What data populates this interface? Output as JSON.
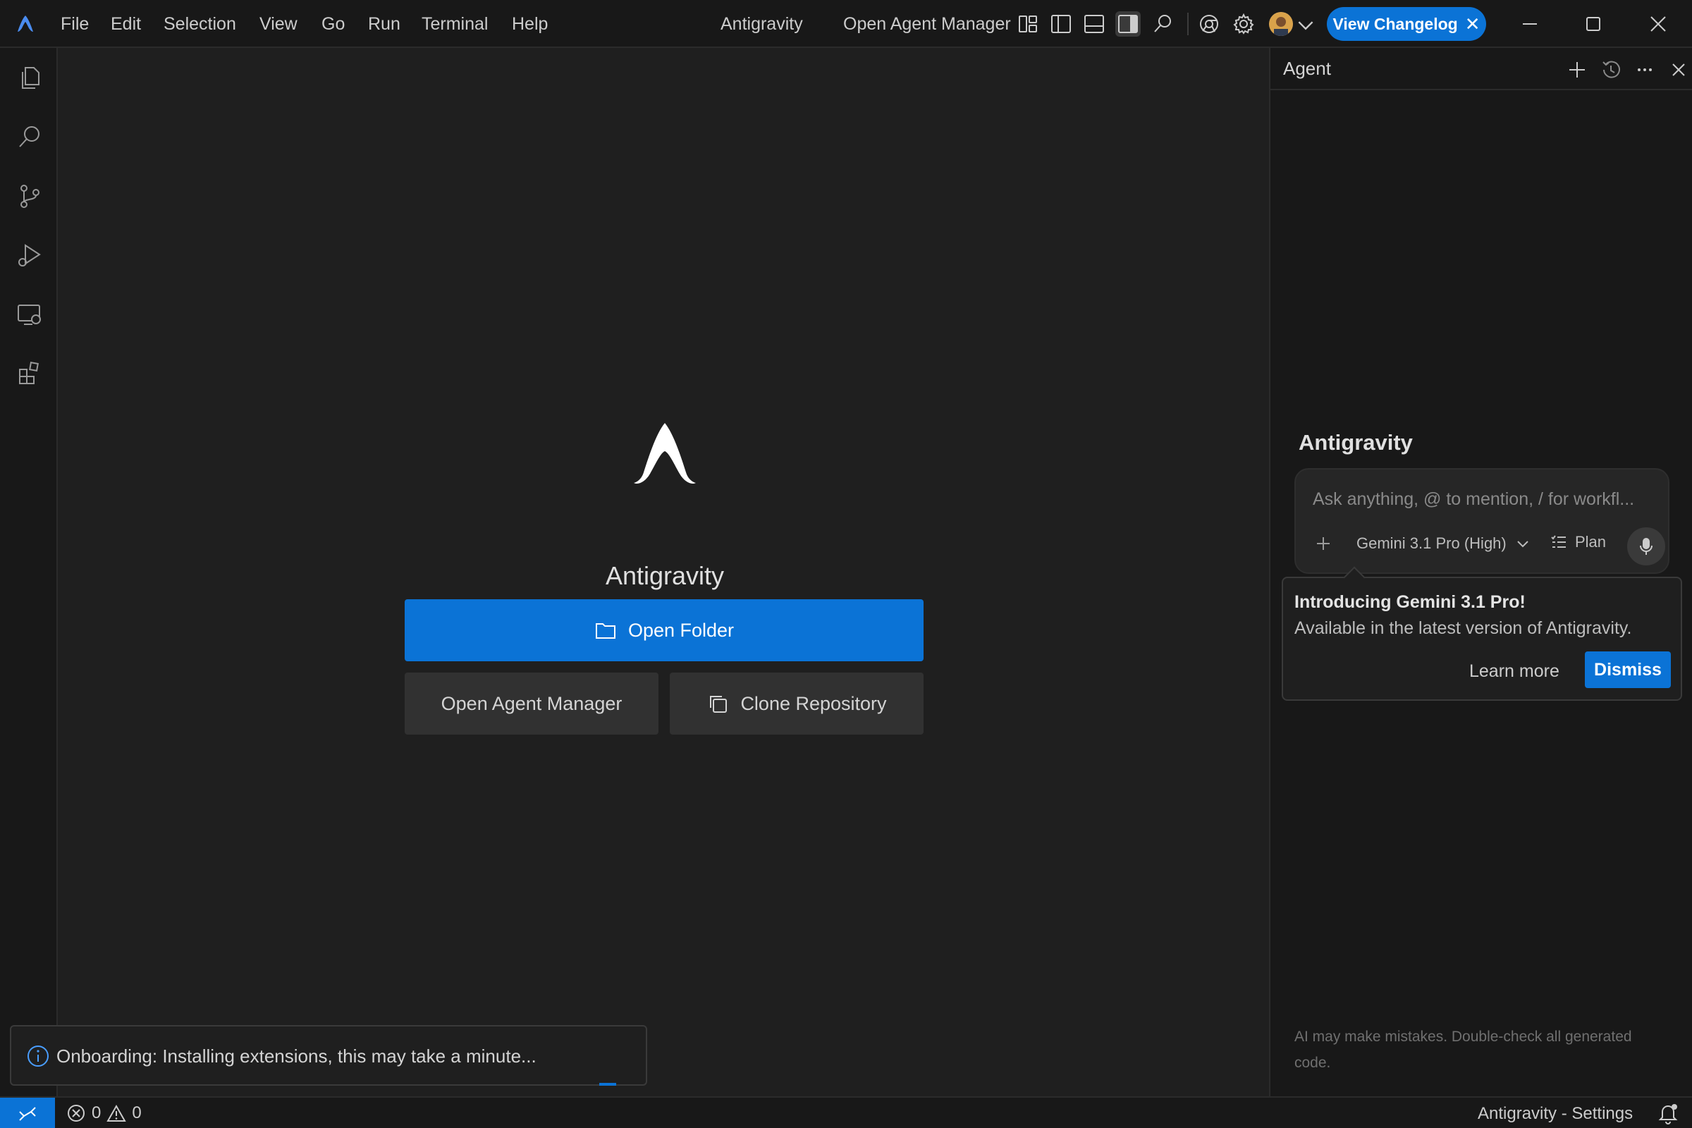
{
  "titlebar": {
    "menu": [
      "File",
      "Edit",
      "Selection",
      "View",
      "Go",
      "Run",
      "Terminal",
      "Help"
    ],
    "window_title": "Antigravity",
    "agent_manager_label": "Open Agent Manager",
    "changelog_label": "View Changelog",
    "changelog_close": "✕"
  },
  "welcome": {
    "title": "Antigravity",
    "open_folder": "Open Folder",
    "open_agent_manager": "Open Agent Manager",
    "clone_repository": "Clone Repository"
  },
  "agent": {
    "header_title": "Agent",
    "brand": "Antigravity",
    "input_placeholder": "Ask anything, @ to mention, / for workfl...",
    "model": "Gemini 3.1 Pro (High)",
    "plan": "Plan",
    "notification": {
      "title": "Introducing Gemini 3.1 Pro!",
      "body": "Available in the latest version of Antigravity.",
      "learn_more": "Learn more",
      "dismiss": "Dismiss"
    },
    "disclaimer": "AI may make mistakes. Double-check all generated code."
  },
  "toast": {
    "message": "Onboarding: Installing extensions, this may take a minute..."
  },
  "statusbar": {
    "errors": "0",
    "warnings": "0",
    "right_label": "Antigravity - Settings"
  },
  "colors": {
    "accent": "#0b73d6",
    "background": "#1f1f1f",
    "chrome": "#181818"
  }
}
